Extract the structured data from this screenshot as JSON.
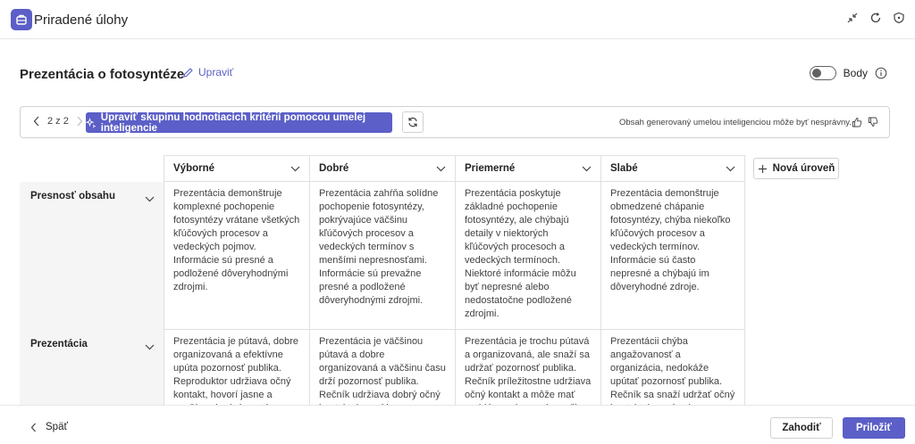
{
  "window": {
    "title": "Priradené úlohy",
    "accent": "#5b5fc7",
    "icons": [
      "collapse-icon",
      "refresh-icon",
      "shield-icon"
    ]
  },
  "header": {
    "title": "Prezentácia o fotosyntéze",
    "edit_label": "Upraviť",
    "points_label": "Body",
    "points_enabled": false
  },
  "toolbar": {
    "pager": "2 z 2",
    "ai_button_label": "Upraviť skupinu hodnotiacich kritérií pomocou umelej inteligencie",
    "disclaimer": "Obsah generovaný umelou inteligenciou môže byť nesprávny."
  },
  "rubric": {
    "levels": [
      "Výborné",
      "Dobré",
      "Priemerné",
      "Slabé"
    ],
    "new_level_label": "Nová úroveň",
    "criteria": [
      {
        "name": "Presnosť obsahu",
        "cells": [
          "Prezentácia demonštruje komplexné pochopenie fotosyntézy vrátane všetkých kľúčových procesov a vedeckých pojmov. Informácie sú presné a podložené dôveryhodnými zdrojmi.",
          "Prezentácia zahŕňa solídne pochopenie fotosyntézy, pokrývajúce väčšinu kľúčových procesov a vedeckých termínov s menšími nepresnosťami. Informácie sú prevažne presné a podložené dôveryhodnými zdrojmi.",
          "Prezentácia poskytuje základné pochopenie fotosyntézy, ale chýbajú detaily v niektorých kľúčových procesoch a vedeckých termínoch. Niektoré informácie môžu byť nepresné alebo nedostatočne podložené zdrojmi.",
          "Prezentácia demonštruje obmedzené chápanie fotosyntézy, chýba niekoľko kľúčových procesov a vedeckých termínov. Informácie sú často nepresné a chýbajú im dôveryhodné zdroje."
        ]
      },
      {
        "name": "Prezentácia",
        "cells": [
          "Prezentácia je pútavá, dobre organizovaná a efektívne upúta pozornosť publika. Reproduktor udržiava očný kontakt, hovorí jasne a používa vhodné gestá.",
          "Prezentácia je väčšinou pútavá a dobre organizovaná a väčšinu času drží pozornosť publika. Rečník udržiava dobrý očný kontakt, hovorí jasne a používa niektoré vhodné gestá.",
          "Prezentácia je trochu pútavá a organizovaná, ale snaží sa udržať pozornosť publika. Rečník príležitostne udržiava očný kontakt a môže mať problémy s jasnosťou reči.",
          "Prezentácii chýba angažovanosť a organizácia, nedokáže upútať pozornosť publika. Rečník sa snaží udržať očný kontakt, hovorí nejasne a nepoužíva vhodné gestá."
        ]
      }
    ]
  },
  "footer": {
    "back_label": "Späť",
    "discard_label": "Zahodiť",
    "attach_label": "Priložiť"
  }
}
